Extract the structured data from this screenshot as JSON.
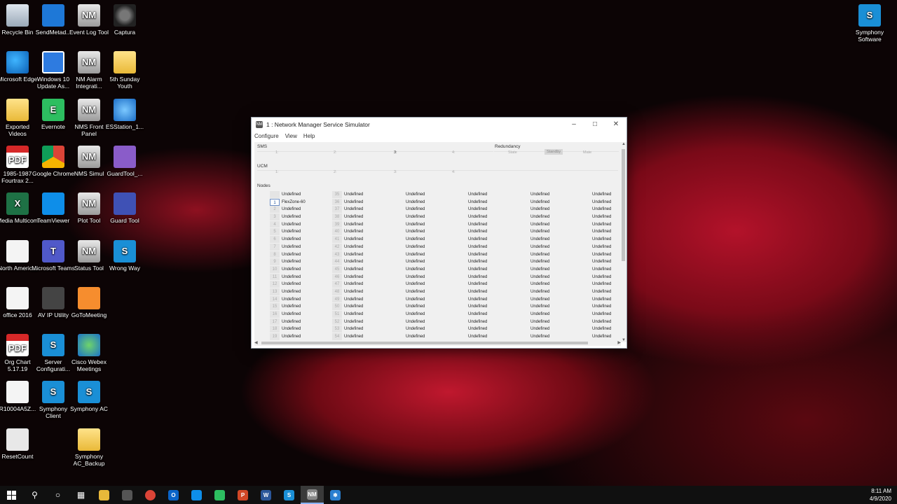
{
  "desktop_icons": [
    {
      "label": "Recycle Bin",
      "icon": "recycle-bin-icon"
    },
    {
      "label": "SendMetad...",
      "icon": "app-icon"
    },
    {
      "label": "Event Log Tool",
      "icon": "nm-icon"
    },
    {
      "label": "Captura",
      "icon": "camera-icon"
    },
    {
      "label": "Microsoft Edge",
      "icon": "edge-icon"
    },
    {
      "label": "Windows 10 Update As...",
      "icon": "windows-icon"
    },
    {
      "label": "NM Alarm Integrati...",
      "icon": "nm-icon"
    },
    {
      "label": "5th Sunday Youth",
      "icon": "folder-icon"
    },
    {
      "label": "Exported Videos",
      "icon": "folder-icon"
    },
    {
      "label": "Evernote",
      "icon": "evernote-icon"
    },
    {
      "label": "NMS Front Panel",
      "icon": "nm-icon"
    },
    {
      "label": "ESStation_1...",
      "icon": "esstation-icon"
    },
    {
      "label": "1985-1987 Fourtrax 2...",
      "icon": "pdf-icon"
    },
    {
      "label": "Google Chrome",
      "icon": "chrome-icon"
    },
    {
      "label": "NMS Simul",
      "icon": "nm-icon"
    },
    {
      "label": "GuardTool_...",
      "icon": "guardtool-icon"
    },
    {
      "label": "Media Multicom",
      "icon": "excel-icon"
    },
    {
      "label": "TeamViewer",
      "icon": "teamviewer-icon"
    },
    {
      "label": "Plot Tool",
      "icon": "nm-icon"
    },
    {
      "label": "Guard Tool",
      "icon": "guard-tool-icon"
    },
    {
      "label": "North Americ...",
      "icon": "file-icon"
    },
    {
      "label": "Microsoft Teams",
      "icon": "teams-icon"
    },
    {
      "label": "Status Tool",
      "icon": "nm-icon"
    },
    {
      "label": "Wrong Way",
      "icon": "symphony-icon"
    },
    {
      "label": "office 2016",
      "icon": "file-icon"
    },
    {
      "label": "AV IP Utility",
      "icon": "av-utility-icon"
    },
    {
      "label": "GoToMeeting",
      "icon": "gotomeeting-icon"
    },
    {
      "label": "Org Chart 5.17.19",
      "icon": "pdf-icon"
    },
    {
      "label": "Server Configurati...",
      "icon": "symphony-icon"
    },
    {
      "label": "Cisco Webex Meetings",
      "icon": "webex-icon"
    },
    {
      "label": "R10004A5Z...",
      "icon": "file-icon"
    },
    {
      "label": "Symphony Client",
      "icon": "symphony-icon"
    },
    {
      "label": "Symphony AC",
      "icon": "symphony-icon"
    },
    {
      "label": "ResetCount",
      "icon": "reset-icon"
    },
    {
      "label": "Symphony AC_Backup",
      "icon": "folder-icon"
    },
    {
      "label": "Symphony Software",
      "icon": "symphony-software-icon"
    }
  ],
  "window": {
    "title": "1 : Network Manager Service Simulator",
    "menu": [
      "Configure",
      "View",
      "Help"
    ],
    "sms_label": "SMS",
    "ucm_label": "UCM",
    "nodes_label": "Nodes",
    "redundancy_label": "Redundancy",
    "redundancy": {
      "state": "State",
      "standby": "Standby",
      "mate": "Mate"
    },
    "sms_slots": [
      "1:",
      "2:",
      "3:",
      "4:"
    ],
    "ucm_slots": [
      "1:",
      "2:",
      "3:",
      "4:"
    ]
  },
  "nodes": {
    "col1_numbers": [
      "",
      "1",
      "2",
      "3",
      "4",
      "5",
      "6",
      "7",
      "8",
      "9",
      "10",
      "11",
      "12",
      "13",
      "14",
      "15",
      "16",
      "17",
      "18",
      "19"
    ],
    "col1_values": [
      "Undefined",
      "FlexZone-60",
      "Undefined",
      "Undefined",
      "Undefined",
      "Undefined",
      "Undefined",
      "Undefined",
      "Undefined",
      "Undefined",
      "Undefined",
      "Undefined",
      "Undefined",
      "Undefined",
      "Undefined",
      "Undefined",
      "Undefined",
      "Undefined",
      "Undefined",
      "Undefined"
    ],
    "col2_numbers": [
      "35",
      "36",
      "37",
      "38",
      "39",
      "40",
      "41",
      "42",
      "43",
      "44",
      "45",
      "46",
      "47",
      "48",
      "49",
      "50",
      "51",
      "52",
      "53",
      "54"
    ],
    "col_value": "Undefined",
    "selected_index": 1
  },
  "taskbar": {
    "time": "8:11 AM",
    "date": "4/9/2020",
    "apps": [
      "file-explorer-icon",
      "store-icon",
      "chrome-icon",
      "outlook-icon",
      "teamviewer-icon",
      "evernote-icon",
      "powerpoint-icon",
      "word-icon",
      "symphony-icon",
      "nm-icon",
      "snowflake-icon"
    ]
  }
}
